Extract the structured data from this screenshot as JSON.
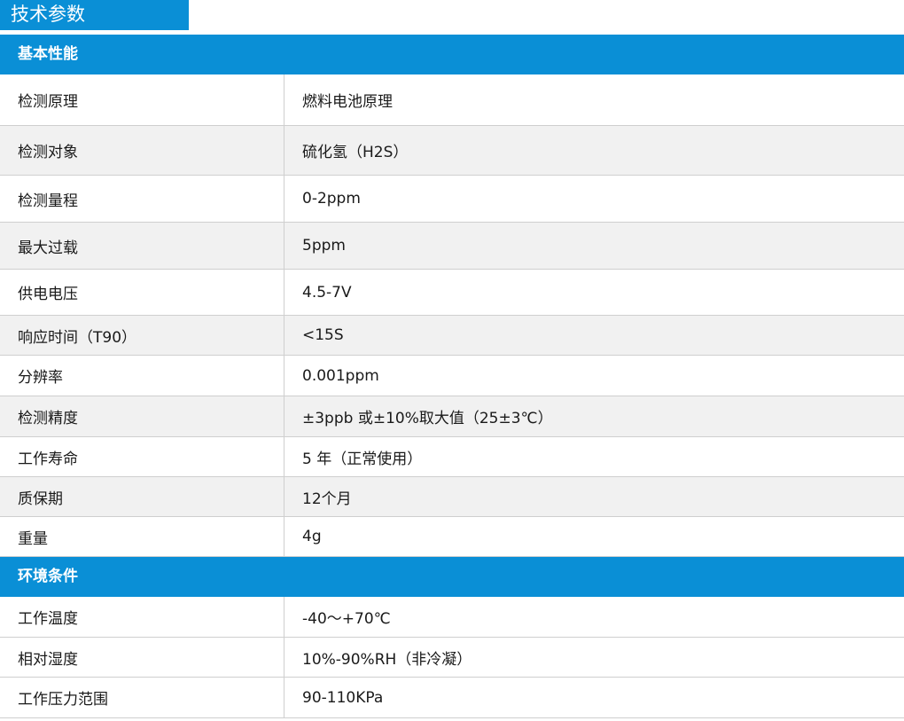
{
  "page_title": "技术参数",
  "sections": [
    {
      "header": "基本性能",
      "rows": [
        {
          "label": "检测原理",
          "value": "燃料电池原理"
        },
        {
          "label": "检测对象",
          "value": "硫化氢（H2S）"
        },
        {
          "label": "检测量程",
          "value": "0-2ppm"
        },
        {
          "label": "最大过载",
          "value": "5ppm"
        },
        {
          "label": "供电电压",
          "value": "4.5-7V"
        },
        {
          "label": "响应时间（T90）",
          "value": "<15S"
        },
        {
          "label": "分辨率",
          "value": "0.001ppm"
        },
        {
          "label": "检测精度",
          "value": "±3ppb 或±10%取大值（25±3℃）"
        },
        {
          "label": "工作寿命",
          "value": "5 年（正常使用）"
        },
        {
          "label": "质保期",
          "value": "12个月"
        },
        {
          "label": "重量",
          "value": "4g"
        }
      ]
    },
    {
      "header": "环境条件",
      "rows": [
        {
          "label": "工作温度",
          "value": "-40～+70℃"
        },
        {
          "label": "相对湿度",
          "value": "10%-90%RH（非冷凝）"
        },
        {
          "label": "工作压力范围",
          "value": "90-110KPa"
        }
      ]
    }
  ]
}
